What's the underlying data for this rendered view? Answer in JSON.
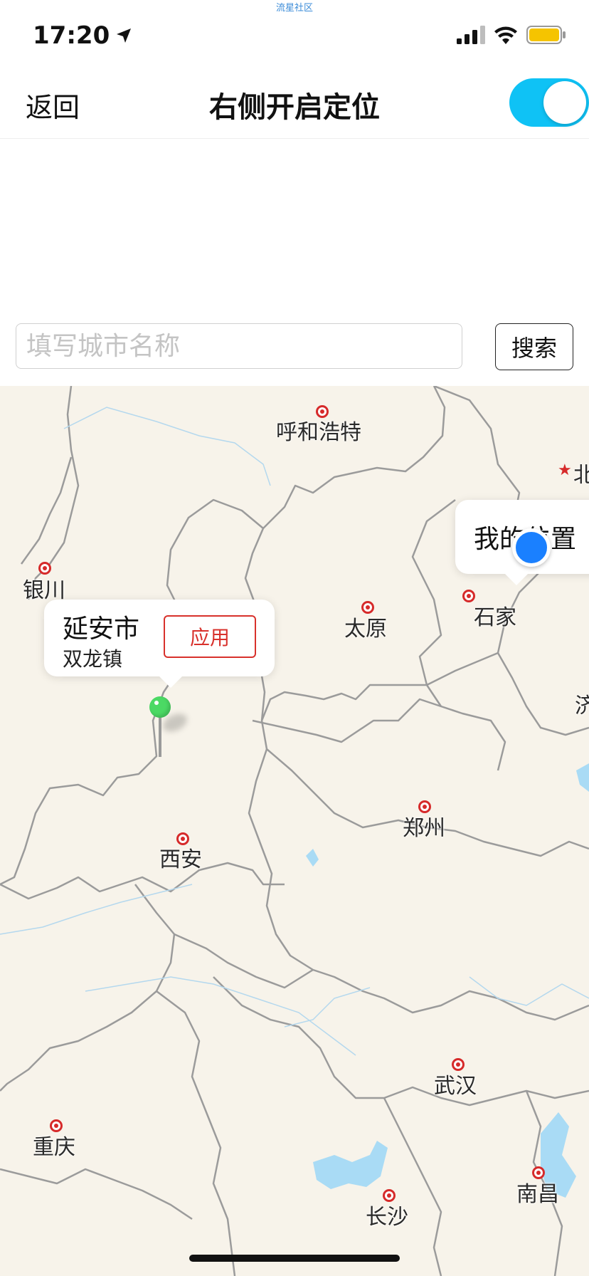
{
  "top_tag": "流星社区",
  "status_bar": {
    "time": "17:20"
  },
  "nav": {
    "back_label": "返回",
    "title": "右侧开启定位",
    "location_toggle_on": true
  },
  "search": {
    "placeholder": "填写城市名称",
    "value": "",
    "button_label": "搜索"
  },
  "map": {
    "cities": [
      "呼和浩特",
      "银川",
      "太原",
      "石家",
      "郑州",
      "西安",
      "武汉",
      "重庆",
      "长沙",
      "南昌",
      "北",
      "济"
    ],
    "selected_callout": {
      "title": "延安市",
      "subtitle": "双龙镇",
      "apply_label": "应用"
    },
    "my_location_label": "我的位置"
  },
  "colors": {
    "accent_toggle": "#0fc2f5",
    "apply_red": "#d8312c",
    "pin_green": "#4bd964",
    "my_location_blue": "#1a80ff",
    "map_bg": "#f7f3ea"
  }
}
